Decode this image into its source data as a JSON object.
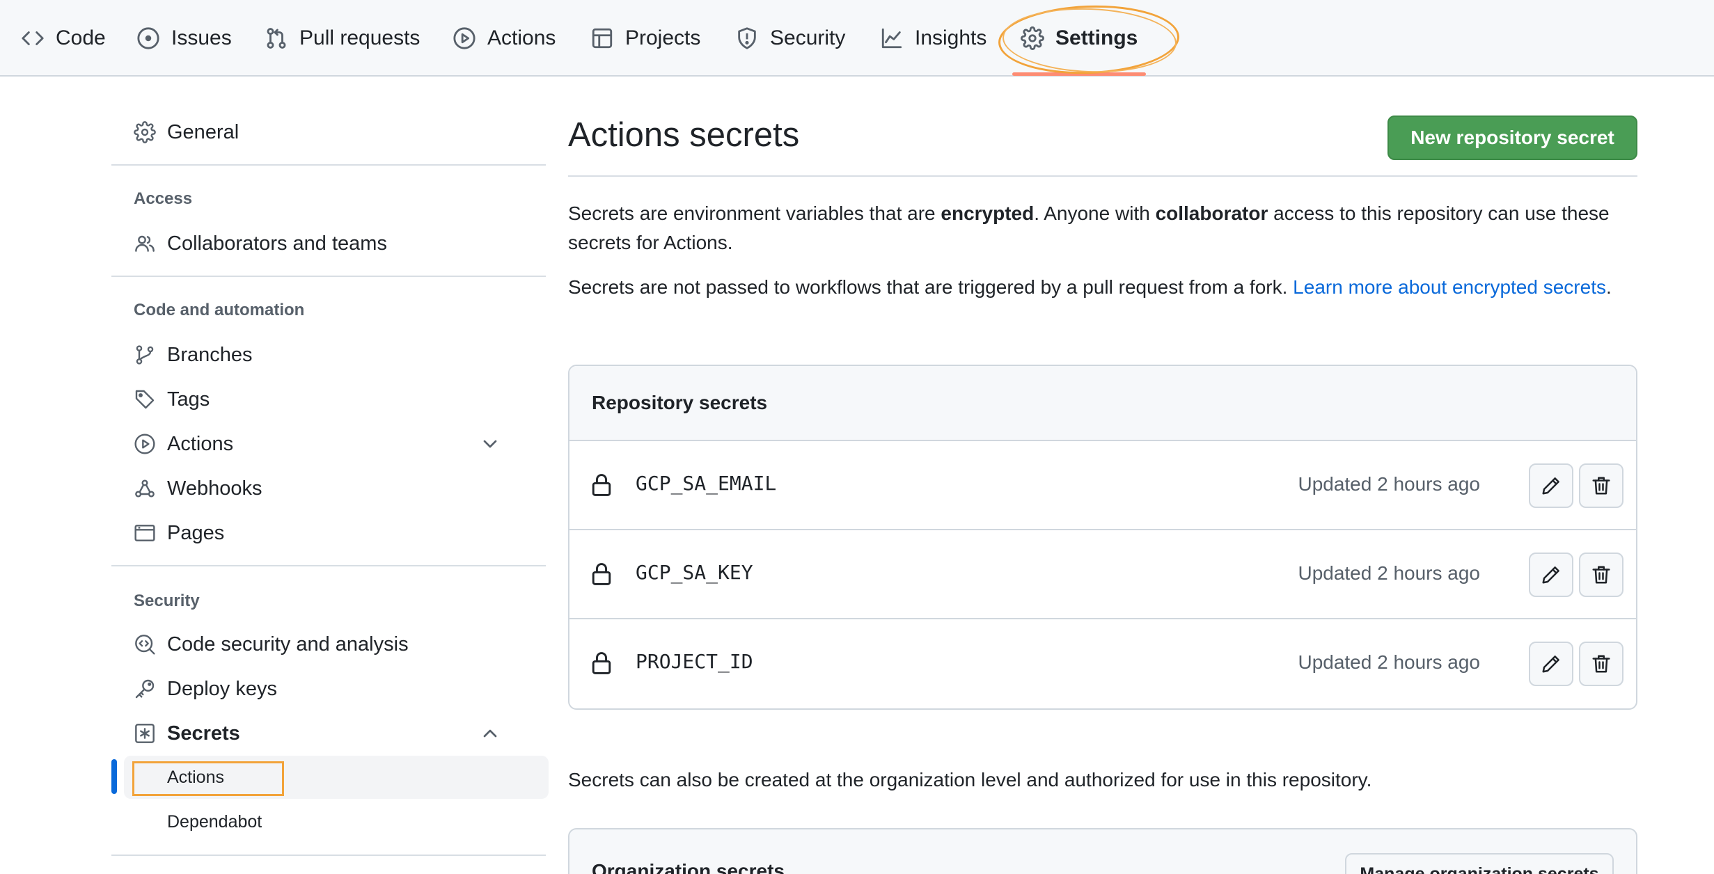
{
  "topnav": {
    "items": [
      {
        "label": "Code",
        "icon": "code-icon"
      },
      {
        "label": "Issues",
        "icon": "issue-opened-icon"
      },
      {
        "label": "Pull requests",
        "icon": "pull-request-icon"
      },
      {
        "label": "Actions",
        "icon": "play-icon"
      },
      {
        "label": "Projects",
        "icon": "table-icon"
      },
      {
        "label": "Security",
        "icon": "shield-icon"
      },
      {
        "label": "Insights",
        "icon": "graph-icon"
      },
      {
        "label": "Settings",
        "icon": "gear-icon",
        "active": true
      }
    ],
    "underline_color": "#fd8c73"
  },
  "sidebar": {
    "general": "General",
    "access_heading": "Access",
    "collaborators": "Collaborators and teams",
    "code_heading": "Code and automation",
    "branches": "Branches",
    "tags": "Tags",
    "actions": "Actions",
    "webhooks": "Webhooks",
    "pages": "Pages",
    "security_heading": "Security",
    "code_security": "Code security and analysis",
    "deploy_keys": "Deploy keys",
    "secrets": "Secrets",
    "secrets_actions": "Actions",
    "secrets_dependabot": "Dependabot",
    "active_color": "#0969da"
  },
  "main": {
    "title": "Actions secrets",
    "new_secret_button": "New repository secret",
    "intro": {
      "p1_a": "Secrets are environment variables that are ",
      "p1_b": "encrypted",
      "p1_c": ". Anyone with ",
      "p1_d": "collaborator",
      "p1_e": " access to this repository can use these secrets for Actions.",
      "p2_a": "Secrets are not passed to workflows that are triggered by a pull request from a fork. ",
      "p2_link": "Learn more about encrypted secrets",
      "p2_end": "."
    },
    "repo_secrets": {
      "header": "Repository secrets",
      "rows": [
        {
          "name": "GCP_SA_EMAIL",
          "updated": "Updated 2 hours ago"
        },
        {
          "name": "GCP_SA_KEY",
          "updated": "Updated 2 hours ago"
        },
        {
          "name": "PROJECT_ID",
          "updated": "Updated 2 hours ago"
        }
      ]
    },
    "org_note": "Secrets can also be created at the organization level and authorized for use in this repository.",
    "org_secrets": {
      "header": "Organization secrets",
      "manage_button": "Manage organization secrets"
    },
    "primary_color": "#4a9d55",
    "link_color": "#0969da"
  }
}
